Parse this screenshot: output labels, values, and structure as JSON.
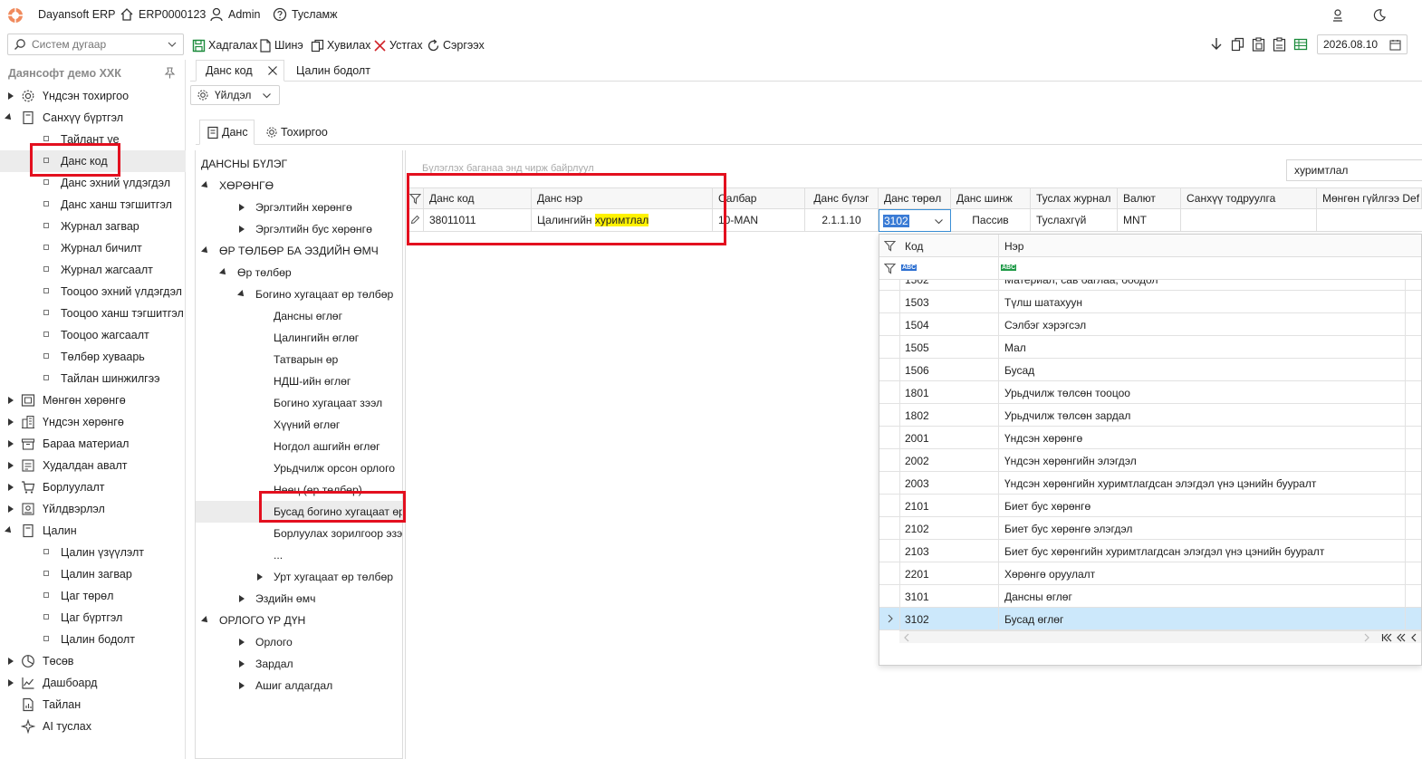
{
  "titlebar": {
    "app_name": "Dayansoft ERP",
    "company_code": "ERP0000123",
    "user": "Admin",
    "help": "Тусламж"
  },
  "toolbar": {
    "search_placeholder": "Систем дугаар",
    "save": "Хадгалах",
    "new": "Шинэ",
    "copy": "Хувилах",
    "delete": "Устгах",
    "refresh": "Сэргээх",
    "date": "2026.08.10"
  },
  "sidebar": {
    "company": "Даянсофт демо ХХК",
    "items": [
      {
        "label": "Үндсэн тохиргоо",
        "type": "group",
        "expanded": false,
        "icon": "gear-icon"
      },
      {
        "label": "Санхүү бүртгэл",
        "type": "group",
        "expanded": true,
        "icon": "ledger-icon"
      },
      {
        "label": "Тайлант үе",
        "type": "sub"
      },
      {
        "label": "Данс код",
        "type": "sub",
        "selected": true
      },
      {
        "label": "Данс эхний үлдэгдэл",
        "type": "sub"
      },
      {
        "label": "Данс ханш тэгшитгэл",
        "type": "sub"
      },
      {
        "label": "Журнал загвар",
        "type": "sub"
      },
      {
        "label": "Журнал бичилт",
        "type": "sub"
      },
      {
        "label": "Журнал жагсаалт",
        "type": "sub"
      },
      {
        "label": "Тооцоо эхний үлдэгдэл",
        "type": "sub"
      },
      {
        "label": "Тооцоо ханш тэгшитгэл",
        "type": "sub"
      },
      {
        "label": "Тооцоо жагсаалт",
        "type": "sub"
      },
      {
        "label": "Төлбөр хуваарь",
        "type": "sub"
      },
      {
        "label": "Тайлан шинжилгээ",
        "type": "sub"
      },
      {
        "label": "Мөнгөн хөрөнгө",
        "type": "group",
        "expanded": false,
        "icon": "safe-icon"
      },
      {
        "label": "Үндсэн хөрөнгө",
        "type": "group",
        "expanded": false,
        "icon": "building-icon"
      },
      {
        "label": "Бараа материал",
        "type": "group",
        "expanded": false,
        "icon": "box-icon"
      },
      {
        "label": "Худалдан авалт",
        "type": "group",
        "expanded": false,
        "icon": "purchase-icon"
      },
      {
        "label": "Борлуулалт",
        "type": "group",
        "expanded": false,
        "icon": "cart-icon"
      },
      {
        "label": "Үйлдвэрлэл",
        "type": "group",
        "expanded": false,
        "icon": "factory-icon"
      },
      {
        "label": "Цалин",
        "type": "group",
        "expanded": true,
        "icon": "salary-icon"
      },
      {
        "label": "Цалин үзүүлэлт",
        "type": "sub"
      },
      {
        "label": "Цалин загвар",
        "type": "sub"
      },
      {
        "label": "Цаг төрөл",
        "type": "sub"
      },
      {
        "label": "Цаг бүртгэл",
        "type": "sub"
      },
      {
        "label": "Цалин бодолт",
        "type": "sub"
      },
      {
        "label": "Төсөв",
        "type": "group",
        "expanded": false,
        "icon": "pie-icon"
      },
      {
        "label": "Дашбоард",
        "type": "group",
        "expanded": false,
        "icon": "dashboard-icon"
      },
      {
        "label": "Тайлан",
        "type": "leaf",
        "icon": "report-icon"
      },
      {
        "label": "AI туслах",
        "type": "leaf",
        "icon": "ai-icon"
      }
    ]
  },
  "doc_tabs": [
    {
      "label": "Данс код",
      "active": true
    },
    {
      "label": "Цалин бодолт",
      "active": false
    }
  ],
  "action_menu": "Үйлдэл",
  "sub_tabs": [
    {
      "label": "Данс",
      "active": true
    },
    {
      "label": "Тохиргоо",
      "active": false
    }
  ],
  "tree": {
    "root": "ДАНСНЫ БҮЛЭГ",
    "nodes": [
      {
        "label": "ХӨРӨНГӨ",
        "level": 1,
        "arrow": "down"
      },
      {
        "label": "Эргэлтийн хөрөнгө",
        "level": 2,
        "arrow": "right"
      },
      {
        "label": "Эргэлтийн бус хөрөнгө",
        "level": 2,
        "arrow": "right"
      },
      {
        "label": "ӨР ТӨЛБӨР БА ЭЗДИЙН ӨМЧ",
        "level": 1,
        "arrow": "down"
      },
      {
        "label": "Өр төлбөр",
        "level": 2,
        "arrow": "down"
      },
      {
        "label": "Богино хугацаат өр төлбөр",
        "level": 3,
        "arrow": "down"
      },
      {
        "label": "Дансны өглөг",
        "level": 4,
        "arrow": ""
      },
      {
        "label": "Цалингийн  өглөг",
        "level": 4,
        "arrow": ""
      },
      {
        "label": "Татварын өр",
        "level": 4,
        "arrow": ""
      },
      {
        "label": "НДШ-ийн өглөг",
        "level": 4,
        "arrow": ""
      },
      {
        "label": "Богино хугацаат зээл",
        "level": 4,
        "arrow": ""
      },
      {
        "label": "Хүүний өглөг",
        "level": 4,
        "arrow": ""
      },
      {
        "label": "Ногдол ашгийн өглөг",
        "level": 4,
        "arrow": ""
      },
      {
        "label": "Урьдчилж орсон орлого",
        "level": 4,
        "arrow": ""
      },
      {
        "label": "Нөөц (өр төлбөр)",
        "level": 4,
        "arrow": ""
      },
      {
        "label": "Бусад богино хугацаат өр",
        "level": 4,
        "arrow": "",
        "selected": true
      },
      {
        "label": "Борлуулах зорилгоор эзэм",
        "level": 4,
        "arrow": ""
      },
      {
        "label": "...",
        "level": 4,
        "arrow": ""
      },
      {
        "label": "Урт хугацаат өр төлбөр",
        "level": 3,
        "arrow": "right"
      },
      {
        "label": "Эздийн өмч",
        "level": 2,
        "arrow": "right"
      },
      {
        "label": "ОРЛОГО ҮР ДҮН",
        "level": 1,
        "arrow": "down"
      },
      {
        "label": "Орлого",
        "level": 2,
        "arrow": "right"
      },
      {
        "label": "Зардал",
        "level": 2,
        "arrow": "right"
      },
      {
        "label": "Ашиг алдагдал",
        "level": 2,
        "arrow": "right"
      }
    ]
  },
  "grid": {
    "group_hint": "Бүлэглэх баганаа энд чирж байрлуул",
    "search_value": "хуримтлал",
    "columns": [
      "Данс код",
      "Данс нэр",
      "Салбар",
      "Данс бүлэг",
      "Данс төрөл",
      "Данс шинж",
      "Туслах журнал",
      "Валют",
      "Санхүү тодруулга",
      "Мөнгөн гүйлгээ Def"
    ],
    "row": {
      "code": "38011011",
      "name_prefix": "Цалингийн ",
      "name_highlight": "хуримтлал",
      "branch": "10-MAN",
      "group": "2.1.1.10",
      "type": "3102",
      "nature": "Пассив",
      "journal": "Туслахгүй",
      "currency": "MNT",
      "note": "",
      "cashflow": ""
    }
  },
  "popup": {
    "col_code": "Код",
    "col_name": "Нэр",
    "filter_code": "ABC",
    "filter_name": "ABC",
    "partial_row": {
      "code": "1502",
      "name": "Материал, сав баглаа, боодол"
    },
    "rows": [
      {
        "code": "1503",
        "name": "Түлш шатахуун"
      },
      {
        "code": "1504",
        "name": "Сэлбэг хэрэгсэл"
      },
      {
        "code": "1505",
        "name": "Мал"
      },
      {
        "code": "1506",
        "name": "Бусад"
      },
      {
        "code": "1801",
        "name": "Урьдчилж төлсөн тооцоо"
      },
      {
        "code": "1802",
        "name": "Урьдчилж төлсөн зардал"
      },
      {
        "code": "2001",
        "name": "Үндсэн хөрөнгө"
      },
      {
        "code": "2002",
        "name": "Үндсэн хөрөнгийн элэгдэл"
      },
      {
        "code": "2003",
        "name": "Үндсэн хөрөнгийн хуримтлагдсан элэгдэл үнэ цэнийн бууралт"
      },
      {
        "code": "2101",
        "name": "Биет бус хөрөнгө"
      },
      {
        "code": "2102",
        "name": "Биет бус хөрөнгө элэгдэл"
      },
      {
        "code": "2103",
        "name": "Биет бус хөрөнгийн хуримтлагдсан элэгдэл үнэ цэнийн бууралт"
      },
      {
        "code": "2201",
        "name": "Хөрөнгө оруулалт"
      },
      {
        "code": "3101",
        "name": "Дансны өглөг"
      },
      {
        "code": "3102",
        "name": "Бусад өглөг",
        "selected": true
      }
    ]
  },
  "colors": {
    "accent_red": "#e3101f",
    "highlight_yellow": "#fff200",
    "selected_blue": "#cce8fb",
    "green_save": "#1a8a3a"
  }
}
